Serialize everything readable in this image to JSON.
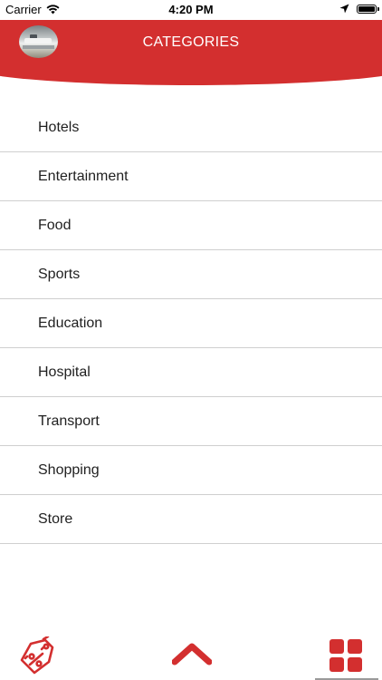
{
  "status_bar": {
    "carrier": "Carrier",
    "time": "4:20 PM",
    "icons": [
      "wifi-icon",
      "location-arrow-icon",
      "battery-icon"
    ]
  },
  "header": {
    "title": "CATEGORIES",
    "background_color": "#d32f2f",
    "avatar": "profile-photo"
  },
  "categories": [
    {
      "label": "Hotels"
    },
    {
      "label": "Entertainment"
    },
    {
      "label": "Food"
    },
    {
      "label": "Sports"
    },
    {
      "label": "Education"
    },
    {
      "label": "Hospital"
    },
    {
      "label": "Transport"
    },
    {
      "label": "Shopping"
    },
    {
      "label": "Store"
    }
  ],
  "bottom_bar": {
    "tabs": [
      {
        "icon": "discount-tags-icon"
      },
      {
        "icon": "chevron-up-icon"
      },
      {
        "icon": "grid-icon",
        "selected": true
      }
    ],
    "accent_color": "#d32f2f"
  }
}
